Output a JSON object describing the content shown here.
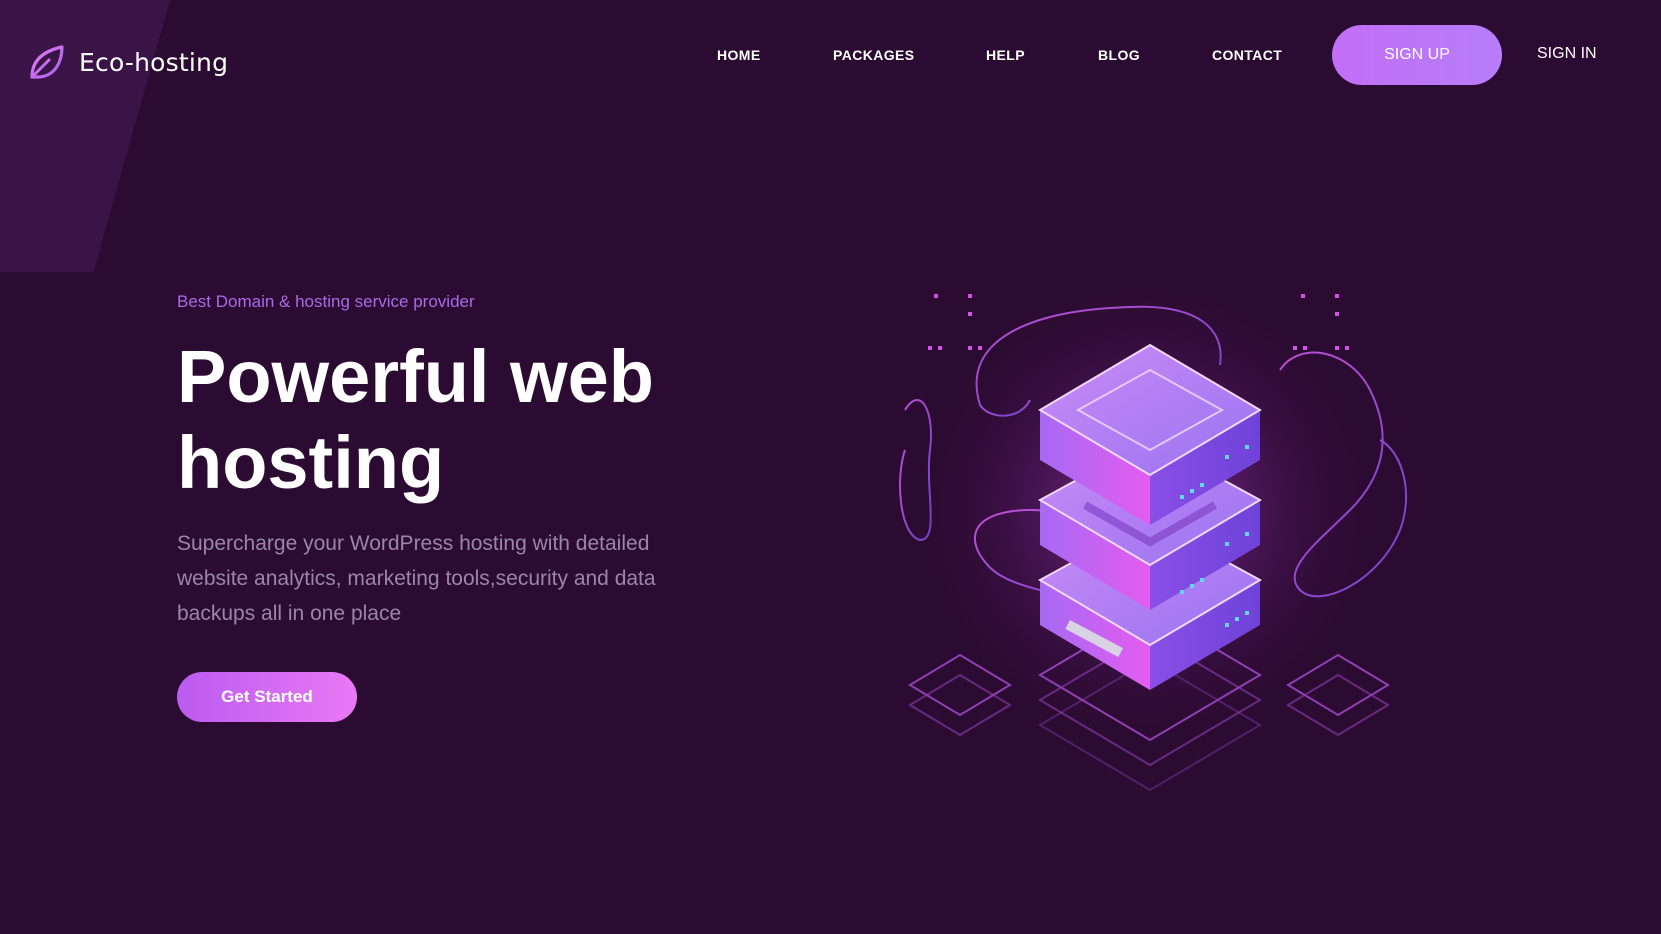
{
  "brand": {
    "name": "Eco-hosting",
    "logo_icon": "leaf-icon",
    "accent": "#b56af5"
  },
  "nav": {
    "items": [
      "HOME",
      "PACKAGES",
      "HELP",
      "BLOG",
      "CONTACT"
    ],
    "signup_label": "SIGN UP",
    "signin_label": "SIGN IN"
  },
  "hero": {
    "tagline": "Best Domain & hosting service provider",
    "headline_line1": "Powerful web",
    "headline_line2": "hosting",
    "description": "Supercharge your WordPress hosting with detailed website analytics, marketing tools,security and data backups all in one place",
    "cta_label": "Get Started"
  },
  "colors": {
    "background": "#2c0b32",
    "tagline": "#a96ae6",
    "description": "#9a86a8",
    "button_gradient_start": "#bb5bf0",
    "button_gradient_end": "#e979f6"
  },
  "illustration": {
    "icon": "server-stack-illustration"
  }
}
